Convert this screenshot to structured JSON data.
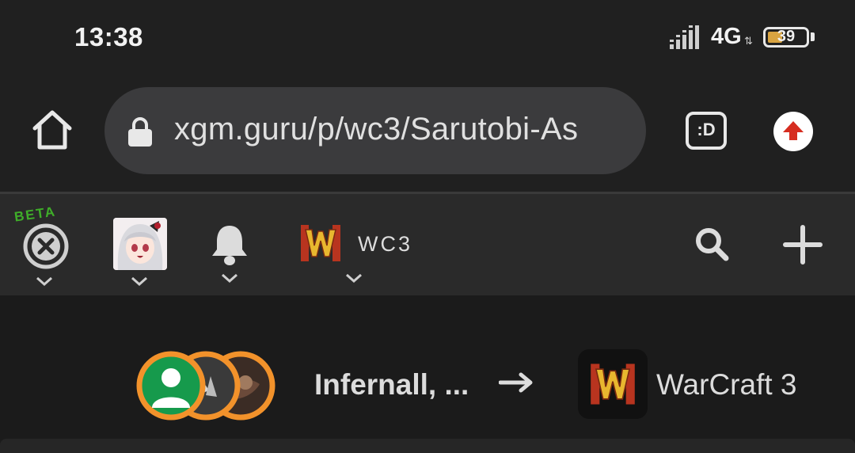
{
  "status_bar": {
    "time": "13:38",
    "network": "4G",
    "battery": "39",
    "battery_level_percent": 39
  },
  "browser": {
    "url": "xgm.guru/p/wc3/Sarutobi-As",
    "tabs_label": ":D",
    "icons": [
      "home-icon",
      "lock-icon",
      "tabs-icon",
      "update-arrow-icon"
    ]
  },
  "site_nav": {
    "beta_label": "BETA",
    "section_label": "WC3",
    "icons": [
      "close-circle-icon",
      "user-avatar",
      "bell-icon",
      "warcraft-logo-icon",
      "search-icon",
      "plus-icon"
    ]
  },
  "post": {
    "authors": "Infernall, ...",
    "arrow": "→",
    "game": "WarCraft 3"
  },
  "colors": {
    "background": "#1d1d1d",
    "nav_background": "#2a2a2a",
    "urlbar": "#3b3b3d",
    "beta_green": "#3fae29",
    "avatar_ring": "#f2922b",
    "update_red": "#d62d20"
  }
}
